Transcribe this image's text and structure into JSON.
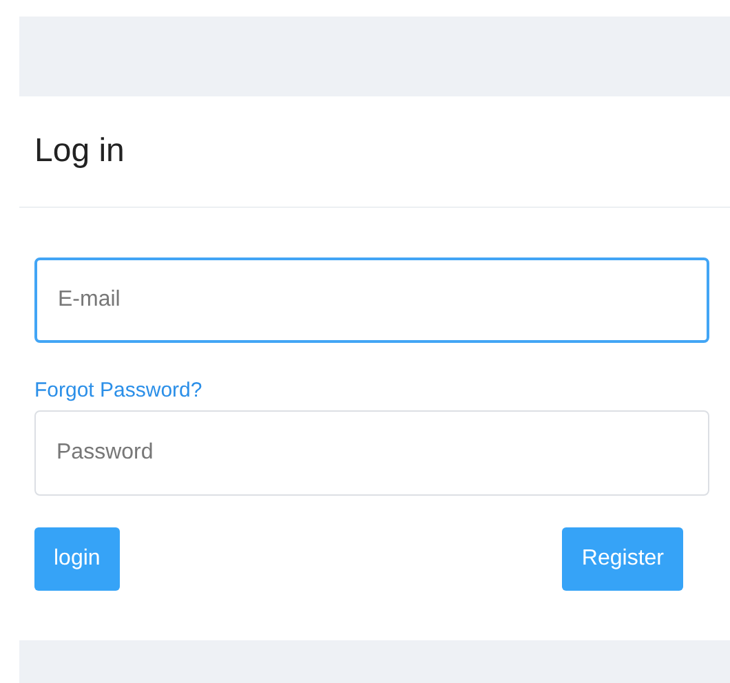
{
  "title": "Log in",
  "fields": [
    {
      "kind": "email",
      "placeholder": "E-mail",
      "focused": true
    },
    {
      "kind": "password",
      "placeholder": "Password",
      "focused": false
    }
  ],
  "forgot_link": "Forgot Password?",
  "buttons": [
    {
      "kind": "login",
      "label": "login"
    },
    {
      "kind": "register",
      "label": "Register"
    }
  ]
}
